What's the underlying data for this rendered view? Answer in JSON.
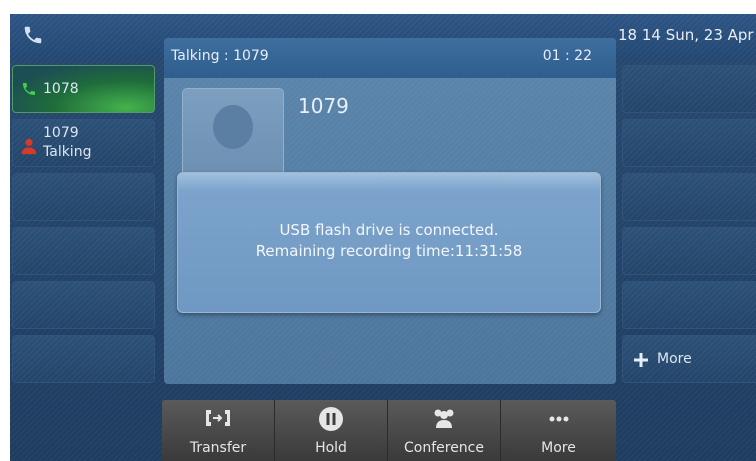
{
  "status_bar": {
    "datetime": "18 14 Sun, 23 Apr"
  },
  "line_keys": [
    {
      "label": "1078",
      "state": "active"
    },
    {
      "label": "1079",
      "status": "Talking"
    },
    {
      "label": ""
    },
    {
      "label": ""
    },
    {
      "label": ""
    },
    {
      "label": ""
    }
  ],
  "right_keys": [
    {
      "label": ""
    },
    {
      "label": ""
    },
    {
      "label": ""
    },
    {
      "label": ""
    },
    {
      "label": ""
    },
    {
      "label": "More"
    }
  ],
  "call": {
    "header_title": "Talking : 1079",
    "timer": "01 : 22",
    "callee": "1079"
  },
  "popup": {
    "line1": "USB flash drive is connected.",
    "line2": "Remaining recording time:11:31:58"
  },
  "softkeys": [
    {
      "label": "Transfer",
      "icon": "transfer-icon"
    },
    {
      "label": "Hold",
      "icon": "pause-icon"
    },
    {
      "label": "Conference",
      "icon": "conference-icon"
    },
    {
      "label": "More",
      "icon": "more-dots-icon"
    }
  ],
  "colors": {
    "background": "#24466b",
    "active_line": "#3da64a",
    "popup": "#7ba3cb",
    "softkey_bar": "#4a4a4a"
  }
}
